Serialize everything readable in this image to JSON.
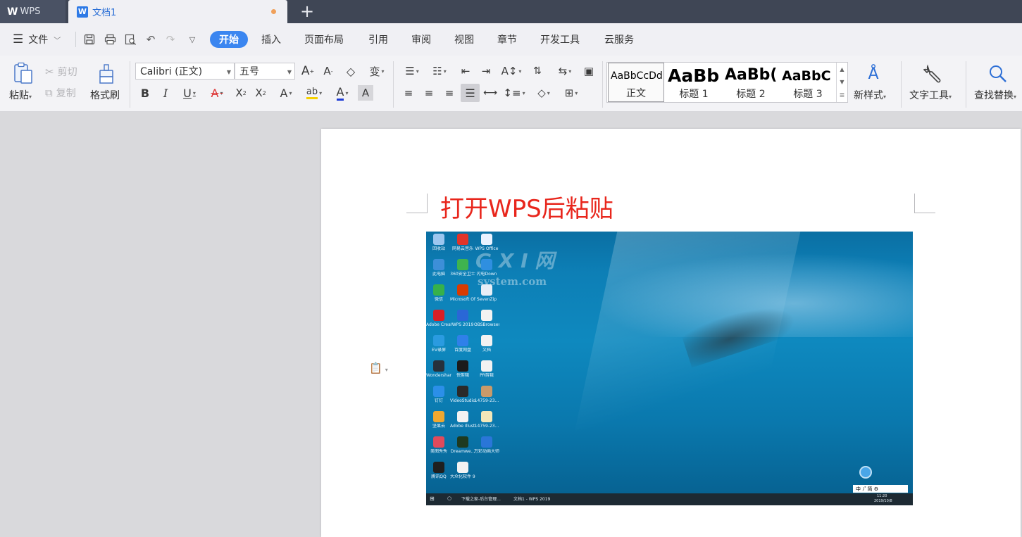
{
  "titlebar": {
    "app_name": "WPS",
    "document_tab": "文档1",
    "new_tab_symbol": "+"
  },
  "menubar": {
    "file_label": "文件",
    "tabs": [
      "开始",
      "插入",
      "页面布局",
      "引用",
      "审阅",
      "视图",
      "章节",
      "开发工具",
      "云服务"
    ],
    "active_tab": "开始"
  },
  "ribbon": {
    "clipboard": {
      "paste": "粘贴",
      "cut": "剪切",
      "copy": "复制",
      "format_painter": "格式刷"
    },
    "font": {
      "name": "Calibri (正文)",
      "size": "五号"
    },
    "styles": [
      {
        "preview": "AaBbCcDd",
        "name": "正文"
      },
      {
        "preview": "AaBb",
        "name": "标题 1"
      },
      {
        "preview": "AaBb(",
        "name": "标题 2"
      },
      {
        "preview": "AaBbC",
        "name": "标题 3"
      }
    ],
    "new_style": "新样式",
    "text_tools": "文字工具",
    "find_replace": "查找替换"
  },
  "document": {
    "heading": "打开WPS后粘贴",
    "heading_color": "#e8261c"
  },
  "embedded_screenshot": {
    "watermark_main": "G X I 网",
    "watermark_sub": "system.com",
    "desktop_icons": [
      {
        "label": "回收站",
        "color": "#9cc6ef"
      },
      {
        "label": "网易云音乐",
        "color": "#e1342a"
      },
      {
        "label": "WPS Office",
        "color": "#e9f2ff"
      },
      {
        "label": "此电脑",
        "color": "#3d8fd8"
      },
      {
        "label": "360安全卫士",
        "color": "#3fb34f"
      },
      {
        "label": "闪电Down",
        "color": "#2f8fe0"
      },
      {
        "label": "微信",
        "color": "#36b14a"
      },
      {
        "label": "Microsoft Office",
        "color": "#d83b01"
      },
      {
        "label": "SevenZip",
        "color": "#e8eef6"
      },
      {
        "label": "Adobe Creati...",
        "color": "#da1f26"
      },
      {
        "label": "WPS 2019",
        "color": "#2a67d6"
      },
      {
        "label": "OBSBrowser",
        "color": "#f2f2f2"
      },
      {
        "label": "EV录屏",
        "color": "#2a9be0"
      },
      {
        "label": "百度网盘",
        "color": "#2f80e9"
      },
      {
        "label": "文档",
        "color": "#f2f2f2"
      },
      {
        "label": "Wondershare Filmora",
        "color": "#27313b"
      },
      {
        "label": "快剪辑",
        "color": "#1b1b1b"
      },
      {
        "label": "PR剪辑",
        "color": "#f2f2f2"
      },
      {
        "label": "钉钉",
        "color": "#2b8fe8"
      },
      {
        "label": "VideoStudio 2019 Train...",
        "color": "#2a2a2a"
      },
      {
        "label": "14759-23...",
        "color": "#c99a6a"
      },
      {
        "label": "坚果云",
        "color": "#f0a830"
      },
      {
        "label": "Adobe Illustrat...",
        "color": "#f2f2f2"
      },
      {
        "label": "14759-23...",
        "color": "#f3e7b9"
      },
      {
        "label": "美图秀秀",
        "color": "#e04a5c"
      },
      {
        "label": "Dreamwe...",
        "color": "#1e3a20"
      },
      {
        "label": "万彩动画大师",
        "color": "#2a76d8"
      },
      {
        "label": "腾讯QQ",
        "color": "#1f1f1f"
      },
      {
        "label": "大众化软件 9.23.xlsx",
        "color": "#f2f2f2"
      }
    ],
    "taskbar": {
      "item1": "下载之家-后台管理...",
      "item2": "文档1 - WPS 2019",
      "time": "11:20",
      "date": "2019/10/8",
      "ime": "中 ﾉ ゚ 简 ⚙"
    }
  }
}
